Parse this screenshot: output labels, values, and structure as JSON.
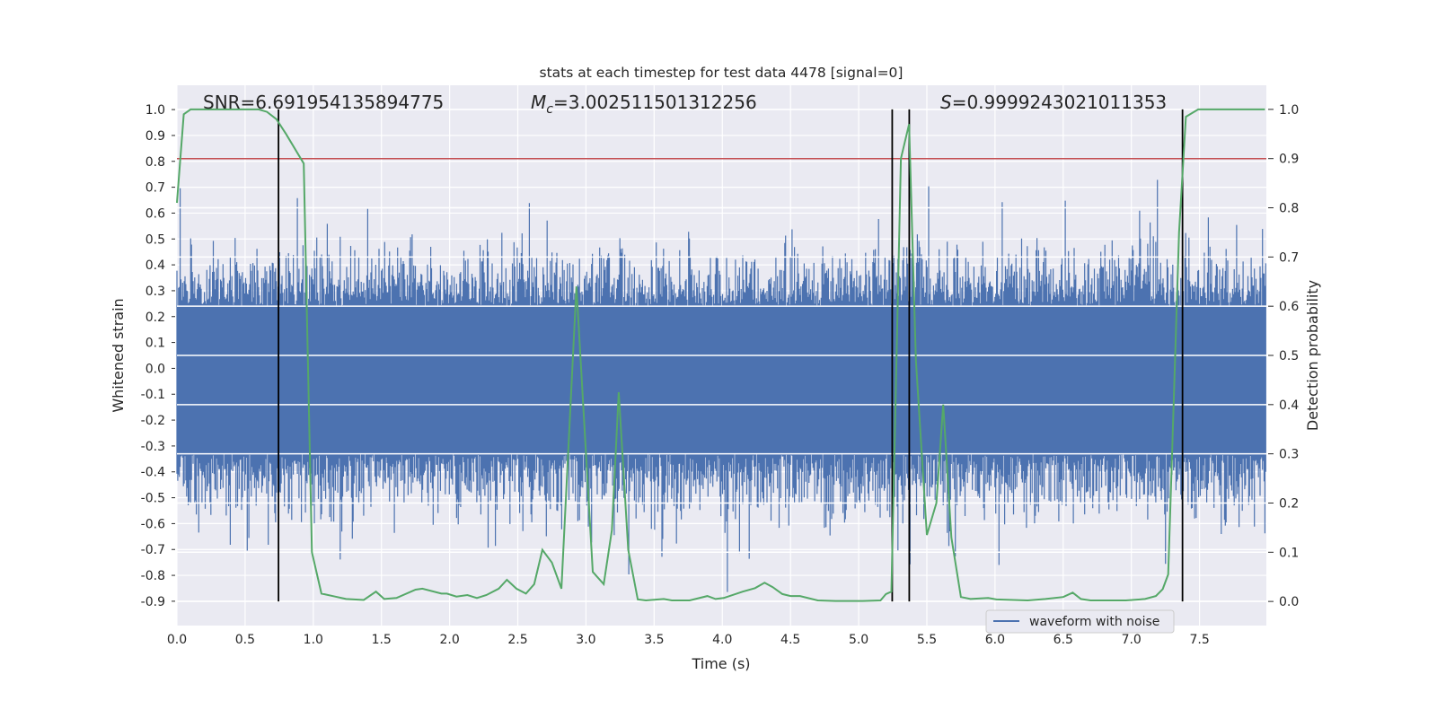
{
  "chart_data": {
    "type": "line",
    "title": "stats at each timestep for test data 4478 [signal=0]",
    "xlabel": "Time (s)",
    "ylabel": "Whitened strain",
    "y2label": "Detection probability",
    "xlim": [
      0,
      7.99
    ],
    "ylim": [
      -0.994,
      1.094
    ],
    "y2lim": [
      -0.049,
      1.049
    ],
    "grid": true,
    "x_ticks": [
      "0.0",
      "0.5",
      "1.0",
      "1.5",
      "2.0",
      "2.5",
      "3.0",
      "3.5",
      "4.0",
      "4.5",
      "5.0",
      "5.5",
      "6.0",
      "6.5",
      "7.0",
      "7.5"
    ],
    "y_ticks": [
      "1.0",
      "0.9",
      "0.8",
      "0.7",
      "0.6",
      "0.5",
      "0.4",
      "0.3",
      "0.2",
      "0.1",
      "0.0",
      "-0.1",
      "-0.2",
      "-0.3",
      "-0.4",
      "-0.5",
      "-0.6",
      "-0.7",
      "-0.8",
      "-0.9"
    ],
    "y2_ticks": [
      "1.0",
      "0.9",
      "0.8",
      "0.7",
      "0.6",
      "0.5",
      "0.4",
      "0.3",
      "0.2",
      "0.1",
      "0.0"
    ],
    "annotations": {
      "snr": "SNR=6.691954135894775",
      "mc_symbol": "M",
      "mc_sub": "c",
      "mc_value": "=3.002511501312256",
      "s_symbol": "S",
      "s_value": "=0.9999243021011353"
    },
    "legend": {
      "placement": "lower-right",
      "entries": [
        "waveform with noise"
      ]
    },
    "waveform": {
      "name": "waveform with noise",
      "color": "#4c72b0",
      "dense_band": [
        -0.33,
        0.24
      ],
      "peak_range": [
        -0.9,
        1.0
      ]
    },
    "detection_probability": {
      "color": "#55a868",
      "x": [
        0.0,
        0.05,
        0.1,
        0.6,
        0.66,
        0.73,
        0.8,
        0.93,
        0.99,
        1.06,
        1.16,
        1.24,
        1.37,
        1.46,
        1.52,
        1.61,
        1.75,
        1.8,
        1.94,
        1.98,
        2.05,
        2.13,
        2.2,
        2.27,
        2.36,
        2.42,
        2.49,
        2.56,
        2.62,
        2.68,
        2.75,
        2.82,
        2.93,
        3.05,
        3.13,
        3.19,
        3.24,
        3.31,
        3.38,
        3.44,
        3.57,
        3.63,
        3.76,
        3.89,
        3.95,
        4.01,
        4.15,
        4.24,
        4.31,
        4.37,
        4.44,
        4.5,
        4.57,
        4.7,
        4.83,
        5.03,
        5.16,
        5.2,
        5.24,
        5.31,
        5.37,
        5.42,
        5.5,
        5.57,
        5.62,
        5.68,
        5.75,
        5.82,
        5.95,
        6.01,
        6.24,
        6.37,
        6.5,
        6.57,
        6.63,
        6.7,
        6.96,
        7.1,
        7.18,
        7.23,
        7.27,
        7.3,
        7.35,
        7.4,
        7.49,
        7.98
      ],
      "y": [
        0.81,
        0.99,
        1.0,
        1.0,
        0.995,
        0.98,
        0.95,
        0.89,
        0.1,
        0.016,
        0.01,
        0.005,
        0.003,
        0.02,
        0.005,
        0.007,
        0.024,
        0.026,
        0.016,
        0.016,
        0.01,
        0.013,
        0.007,
        0.013,
        0.026,
        0.044,
        0.026,
        0.016,
        0.035,
        0.105,
        0.079,
        0.026,
        0.64,
        0.06,
        0.035,
        0.145,
        0.425,
        0.105,
        0.004,
        0.002,
        0.005,
        0.002,
        0.002,
        0.011,
        0.005,
        0.007,
        0.02,
        0.027,
        0.038,
        0.029,
        0.015,
        0.011,
        0.011,
        0.002,
        0.001,
        0.001,
        0.002,
        0.015,
        0.02,
        0.9,
        0.97,
        0.49,
        0.135,
        0.2,
        0.4,
        0.13,
        0.009,
        0.005,
        0.007,
        0.004,
        0.002,
        0.005,
        0.009,
        0.018,
        0.005,
        0.002,
        0.002,
        0.005,
        0.011,
        0.025,
        0.055,
        0.31,
        0.75,
        0.985,
        1.0,
        1.0
      ]
    },
    "threshold": {
      "value": 0.9,
      "axis": "y2",
      "color": "#c44e52"
    },
    "vertical_lines": {
      "x": [
        0.745,
        5.246,
        5.371,
        7.375
      ],
      "color": "#000000"
    }
  }
}
